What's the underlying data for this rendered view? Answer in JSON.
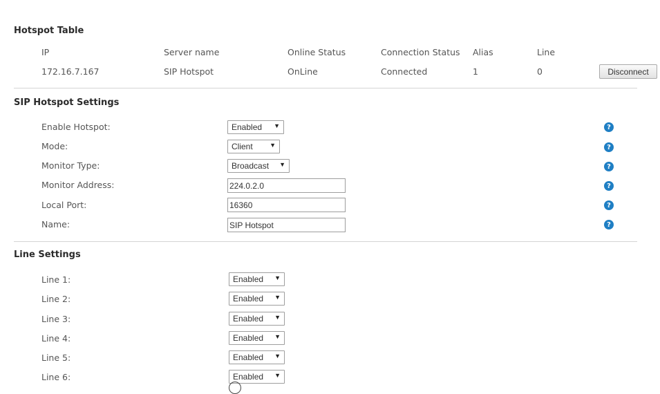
{
  "hotspot_table": {
    "title": "Hotspot Table",
    "columns": [
      "IP",
      "Server name",
      "Online Status",
      "Connection Status",
      "Alias",
      "Line"
    ],
    "rows": [
      {
        "ip": "172.16.7.167",
        "server_name": "SIP Hotspot",
        "online_status": "OnLine",
        "connection_status": "Connected",
        "alias": "1",
        "line": "0",
        "action": "Disconnect"
      }
    ]
  },
  "sip_hotspot_settings": {
    "title": "SIP Hotspot Settings",
    "fields": [
      {
        "label": "Enable Hotspot:",
        "type": "select",
        "value": "Enabled"
      },
      {
        "label": "Mode:",
        "type": "select",
        "value": "Client"
      },
      {
        "label": "Monitor Type:",
        "type": "select",
        "value": "Broadcast"
      },
      {
        "label": "Monitor Address:",
        "type": "text",
        "value": "224.0.2.0"
      },
      {
        "label": "Local Port:",
        "type": "text",
        "value": "16360"
      },
      {
        "label": "Name:",
        "type": "text",
        "value": "SIP Hotspot"
      }
    ],
    "help_icon": "question-circle-icon",
    "help_glyph": "?"
  },
  "line_settings": {
    "title": "Line Settings",
    "lines": [
      {
        "label": "Line 1:",
        "value": "Enabled"
      },
      {
        "label": "Line 2:",
        "value": "Enabled"
      },
      {
        "label": "Line 3:",
        "value": "Enabled"
      },
      {
        "label": "Line 4:",
        "value": "Enabled"
      },
      {
        "label": "Line 5:",
        "value": "Enabled"
      },
      {
        "label": "Line 6:",
        "value": "Enabled"
      }
    ]
  },
  "dropdown_arrow_glyph": "▼",
  "colors": {
    "help_icon": "#1f7fc4",
    "divider": "#d4d4d4"
  }
}
